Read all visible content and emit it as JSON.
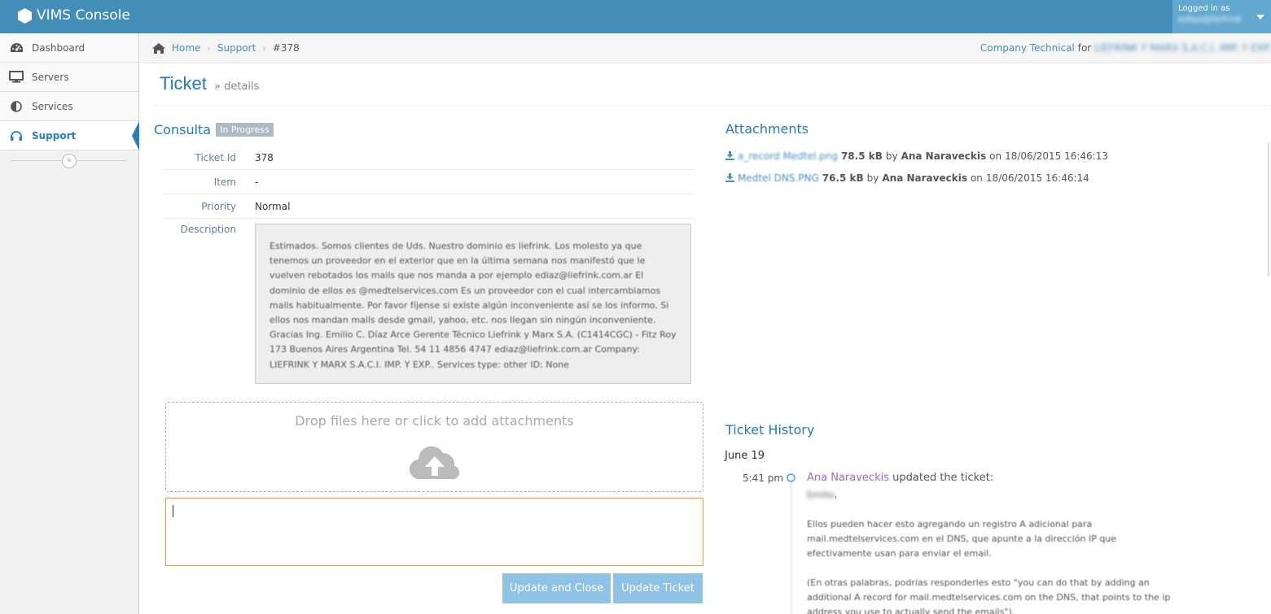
{
  "app": {
    "title": "VIMS Console",
    "colors": {
      "accent": "#438eb9",
      "link": "#4c8fbd",
      "title": "#2679b5",
      "focus": "#f59942",
      "button": "#8ec3e6"
    }
  },
  "user": {
    "label": "Logged in as",
    "value": "ediaz@liefrink"
  },
  "sidebar": {
    "items": [
      {
        "label": "Dashboard",
        "icon": "dashboard-icon"
      },
      {
        "label": "Servers",
        "icon": "desktop-icon"
      },
      {
        "label": "Services",
        "icon": "adjust-icon"
      },
      {
        "label": "Support",
        "icon": "headphones-icon",
        "active": true
      }
    ],
    "collapse_glyph": "«"
  },
  "breadcrumbs": {
    "home": "Home",
    "support": "Support",
    "current": "#378",
    "sep": "›"
  },
  "company": {
    "label": "Company Technical",
    "for": "for",
    "name": "LIEFRINK Y MARX S.A.C.I. IMP. Y EXP."
  },
  "page": {
    "title": "Ticket",
    "subtitle": "» details"
  },
  "ticket": {
    "subject": "Consulta",
    "status": "In Progress",
    "fields": [
      {
        "key": "Ticket Id",
        "value": "378"
      },
      {
        "key": "Item",
        "value": "-"
      },
      {
        "key": "Priority",
        "value": "Normal"
      }
    ],
    "description_label": "Description",
    "description": "Estimados. Somos clientes de Uds. Nuestro dominio es liefrink. Los molesto ya que tenemos un proveedor en el exterior que en la última semana nos manifestó que le vuelven rebotados los mails que nos manda a por ejemplo ediaz@liefrink.com.ar El dominio de ellos es @medtelservices.com Es un proveedor con el cual intercambiamos mails habitualmente. Por favor fíjense si existe algún inconveniente así se los informo. Si ellos nos mandan mails desde gmail, yahoo, etc. nos llegan sin ningún inconveniente. Gracias Ing. Emilio C. Díaz Arce Gerente Técnico Liefrink y Marx S.A. (C1414CGC) - Fitz Roy 173 Buenos Aires Argentina Tel. 54 11 4856 4747 ediaz@liefrink.com.ar Company: LIEFRINK Y MARX S.A.C.I. IMP. Y EXP.. Services type: other ID: None"
  },
  "dropzone": {
    "message": "Drop files here or click to add attachments",
    "icon": "cloud-upload-icon"
  },
  "reply": {
    "value": ""
  },
  "buttons": {
    "update_close": "Update and Close",
    "update": "Update Ticket"
  },
  "attachments": {
    "title": "Attachments",
    "items": [
      {
        "name": "a_record Medtel.png",
        "size": "78.5 kB",
        "by": "by",
        "author": "Ana Naraveckis",
        "on": "on",
        "date": "18/06/2015 16:46:13"
      },
      {
        "name": "Medtel DNS.PNG",
        "size": "76.5 kB",
        "by": "by",
        "author": "Ana Naraveckis",
        "on": "on",
        "date": "18/06/2015 16:46:14"
      }
    ]
  },
  "history": {
    "title": "Ticket History",
    "date": "June 19",
    "entries": [
      {
        "time": "5:41 pm",
        "author": "Ana Naraveckis",
        "action": "updated the ticket:",
        "greeting": "Emilio",
        "greeting_suffix": ",",
        "paragraphs": [
          "Ellos pueden hacer esto agregando un registro A adicional para mail.medtelservices.com en el DNS, que apunte a la dirección IP que efectivamente usan para enviar el email.",
          "(En otras palabras, podrías responderles esto \"you can do that by adding an additional A record for mail.medtelservices.com on the DNS, that points to the ip address you use to actually send the emails\")."
        ]
      }
    ]
  }
}
